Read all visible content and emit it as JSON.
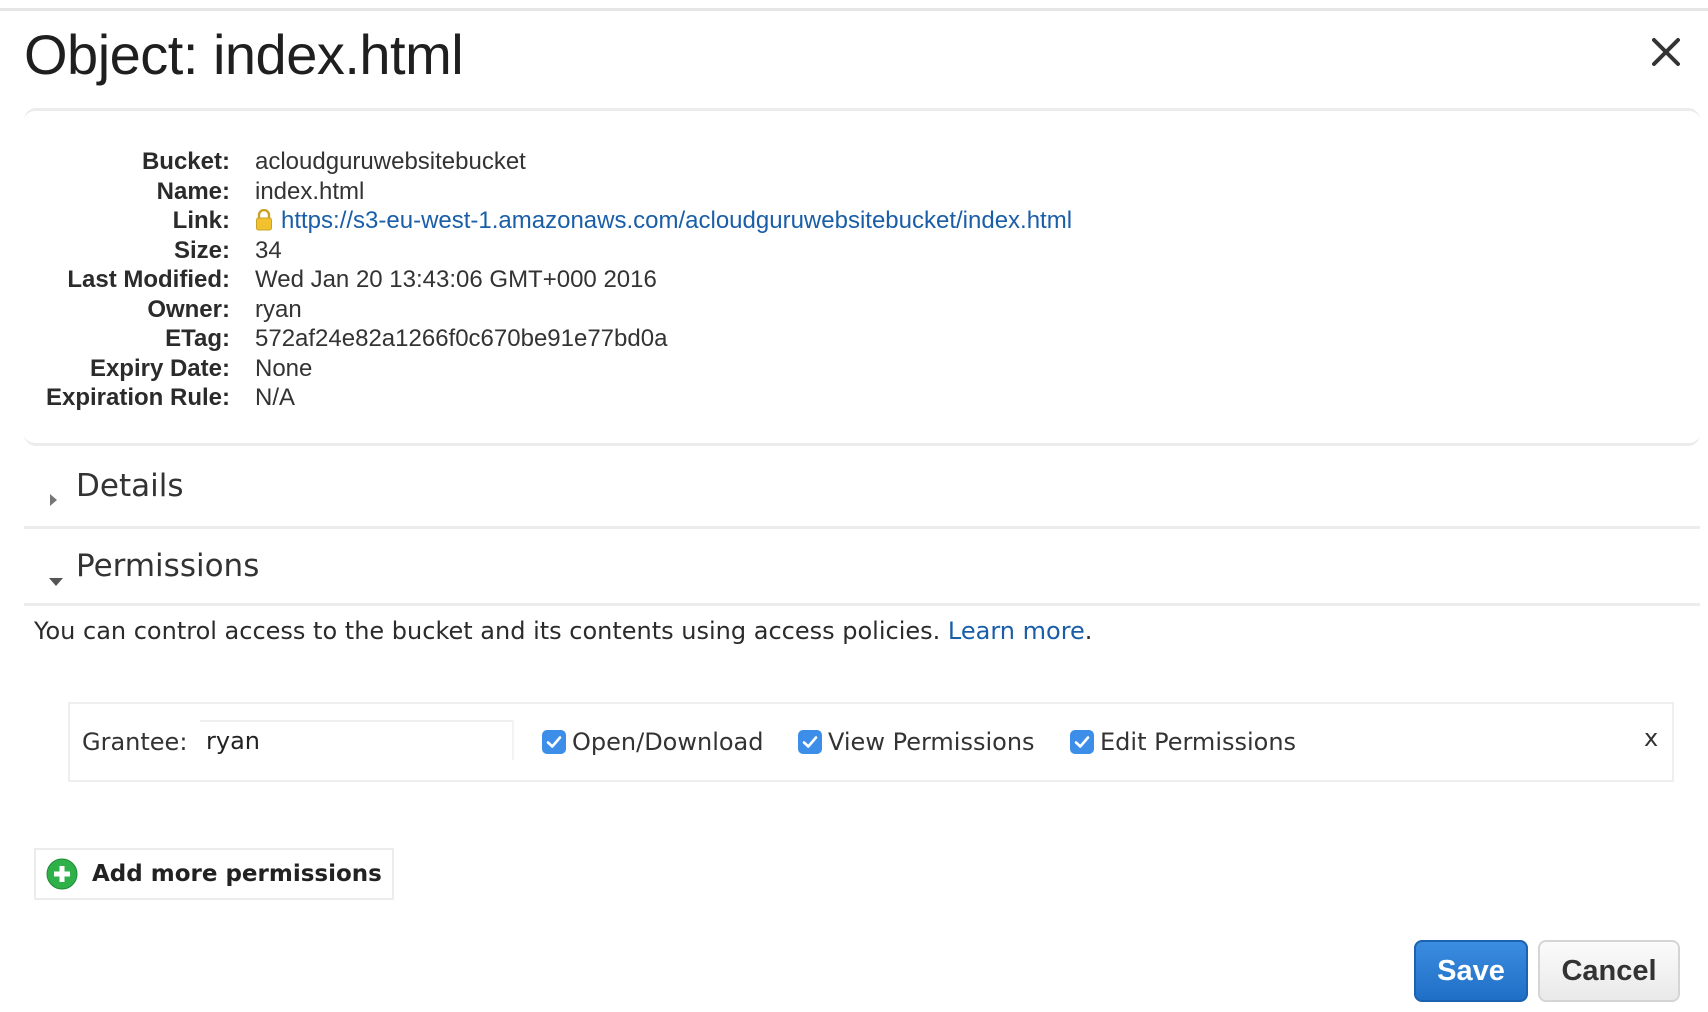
{
  "dialog": {
    "title": "Object: index.html",
    "close_icon": "close-icon"
  },
  "properties": [
    {
      "label": "Bucket:",
      "value": "acloudguruwebsitebucket"
    },
    {
      "label": "Name:",
      "value": "index.html"
    },
    {
      "label": "Link:",
      "value": "https://s3-eu-west-1.amazonaws.com/acloudguruwebsitebucket/index.html",
      "icon": "lock-icon"
    },
    {
      "label": "Size:",
      "value": "34"
    },
    {
      "label": "Last Modified:",
      "value": "Wed Jan 20 13:43:06 GMT+000 2016"
    },
    {
      "label": "Owner:",
      "value": "ryan"
    },
    {
      "label": "ETag:",
      "value": "572af24e82a1266f0c670be91e77bd0a"
    },
    {
      "label": "Expiry Date:",
      "value": "None"
    },
    {
      "label": "Expiration Rule:",
      "value": "N/A"
    }
  ],
  "sections": {
    "details": {
      "label": "Details",
      "expanded": false
    },
    "permissions": {
      "label": "Permissions",
      "expanded": true
    }
  },
  "permissions": {
    "description": "You can control access to the bucket and its contents using access policies.",
    "learn_more": "Learn more",
    "grantee_label": "Grantee:",
    "grantee_value": "ryan",
    "checkboxes": [
      {
        "label": "Open/Download",
        "checked": true
      },
      {
        "label": "View Permissions",
        "checked": true
      },
      {
        "label": "Edit Permissions",
        "checked": true
      }
    ],
    "remove_label": "x",
    "add_more_label": "Add more permissions"
  },
  "buttons": {
    "save": "Save",
    "cancel": "Cancel"
  },
  "colors": {
    "link": "#1a5ea8",
    "primary_button": "#2a7bd4",
    "checkbox": "#3d8ee8",
    "add_icon": "#2fb14a"
  }
}
